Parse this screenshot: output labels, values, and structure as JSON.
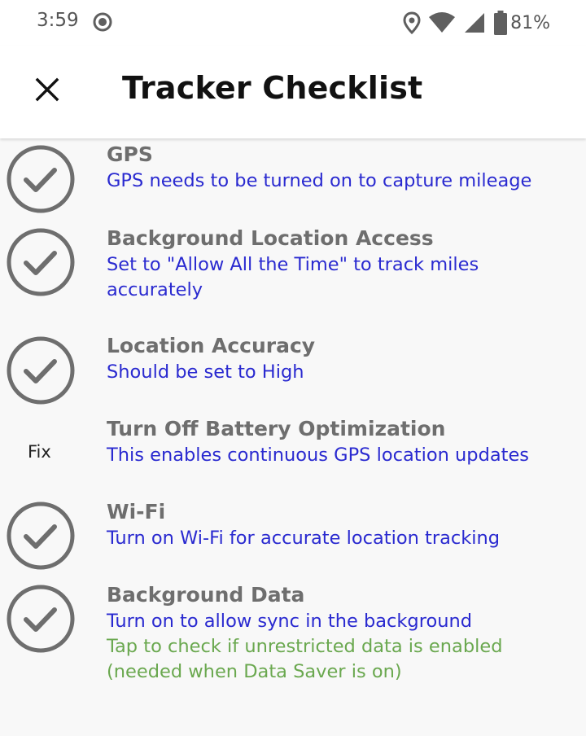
{
  "status_bar": {
    "time": "3:59",
    "battery": "81%",
    "icons": [
      "record-icon",
      "location-pin-icon",
      "wifi-icon",
      "cell-signal-icon",
      "battery-icon"
    ]
  },
  "header": {
    "title": "Tracker Checklist",
    "close_icon": "close-icon"
  },
  "colors": {
    "title_gray": "#6e6e6e",
    "description_blue": "#2a2ad0",
    "hint_green": "#6aa84f",
    "check_gray": "#6e6e6e"
  },
  "items": [
    {
      "title": "GPS",
      "description": "GPS needs to be turned on to capture mileage",
      "status": "check-circle-icon"
    },
    {
      "title": "Background Location Access",
      "description": "Set to \"Allow All the Time\" to track miles accurately",
      "status": "check-circle-icon"
    },
    {
      "title": "Location Accuracy",
      "description": "Should be set to High",
      "status": "check-circle-icon"
    },
    {
      "title": "Turn Off Battery Optimization",
      "description": "This enables continuous GPS location updates",
      "fix_label": "Fix"
    },
    {
      "title": "Wi-Fi",
      "description": "Turn on Wi-Fi for accurate location tracking",
      "status": "check-circle-icon"
    },
    {
      "title": "Background Data",
      "description": "Turn on to allow sync in the background",
      "extra": "Tap to check if unrestricted data is enabled (needed when Data Saver is on)",
      "status": "check-circle-icon"
    }
  ]
}
